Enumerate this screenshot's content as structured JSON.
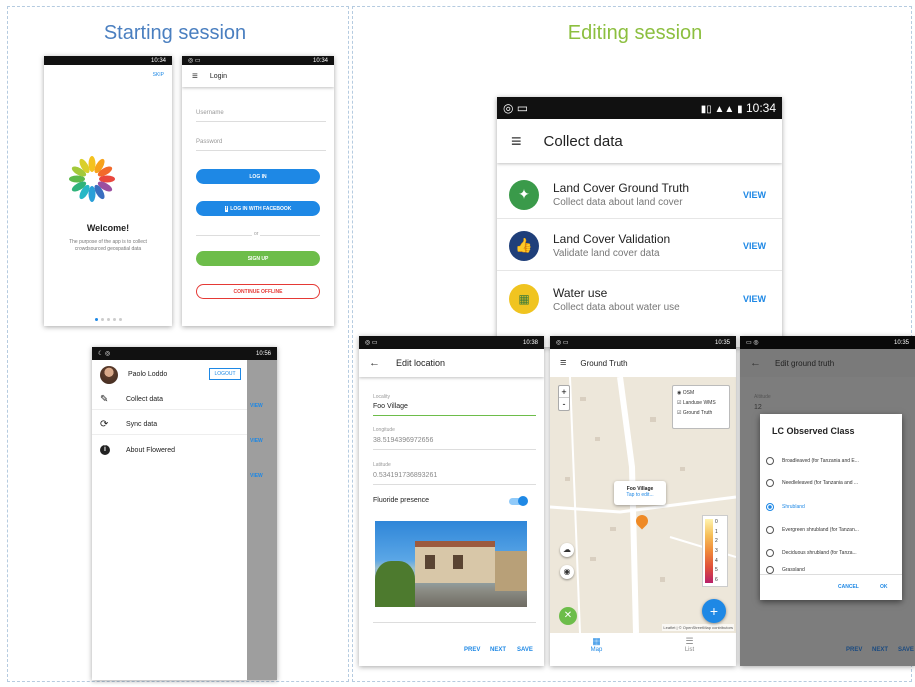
{
  "sections": {
    "starting": "Starting session",
    "editing": "Editing session"
  },
  "colors": {
    "blue": "#1e88e5",
    "green": "#6dbd4a",
    "red": "#e53935",
    "title_blue": "#4a7fc0",
    "title_green": "#8cbf3f"
  },
  "status": {
    "t1034": "10:34",
    "t1056": "10:56",
    "t1038": "10:38",
    "t1035": "10:35"
  },
  "welcome": {
    "skip": "SKIP",
    "title": "Welcome!",
    "desc": "The purpose of the app is to collect crowdsourced geospatial data",
    "logo_icon": "flower-logo-icon"
  },
  "login": {
    "title": "Login",
    "username": "Username",
    "password": "Password",
    "login_btn": "LOG IN",
    "facebook_btn": "LOG IN WITH FACEBOOK",
    "or": "or",
    "signup_btn": "SIGN UP",
    "offline_btn": "CONTINUE OFFLINE"
  },
  "drawer": {
    "user": "Paolo Loddo",
    "logout": "LOGOUT",
    "items": [
      {
        "label": "Collect data",
        "icon": "pencil-icon"
      },
      {
        "label": "Sync data",
        "icon": "sync-icon"
      },
      {
        "label": "About Flowered",
        "icon": "info-icon"
      }
    ],
    "bg_views": [
      "VIEW",
      "VIEW",
      "VIEW"
    ]
  },
  "collect": {
    "title": "Collect data",
    "items": [
      {
        "title": "Land Cover Ground Truth",
        "desc": "Collect data about land cover",
        "action": "VIEW",
        "icon": "compass-icon"
      },
      {
        "title": "Land Cover Validation",
        "desc": "Validate land cover data",
        "action": "VIEW",
        "icon": "thumbs-up-icon"
      },
      {
        "title": "Water use",
        "desc": "Collect data about water use",
        "action": "VIEW",
        "icon": "map-icon"
      }
    ]
  },
  "edit_location": {
    "title": "Edit location",
    "locality_label": "Locality",
    "locality_value": "Foo Village",
    "longitude_label": "Longitude",
    "longitude_value": "38.5194396972656",
    "latitude_label": "Latitude",
    "latitude_value": "0.534191736893261",
    "fluoride_label": "Fluoride presence",
    "fluoride_on": true,
    "prev": "PREV",
    "next": "NEXT",
    "save": "SAVE"
  },
  "ground_truth": {
    "title": "Ground Truth",
    "layers": [
      "OSM",
      "Landuse WMS",
      "Ground Truth"
    ],
    "popup_title": "Foo Village",
    "popup_link": "Tap to edit...",
    "legend": [
      "0",
      "1",
      "2",
      "3",
      "4",
      "5",
      "6"
    ],
    "zoom_in": "+",
    "zoom_out": "-",
    "attribution": "Leaflet | © OpenStreetMap contributors",
    "fab": "+",
    "tab_map": "Map",
    "tab_list": "List"
  },
  "edit_gt": {
    "title": "Edit ground truth",
    "altitude_label": "Altitude",
    "altitude_value": "12",
    "dialog_title": "LC Observed Class",
    "options": [
      "Broadleaved (for Tanzania and E...",
      "Needleleaved (for Tanzania and ...",
      "Shrubland",
      "Evergreen shrubland (for Tanzan...",
      "Deciduous shrubland (for Tanza...",
      "Grassland"
    ],
    "selected": 2,
    "cancel": "CANCEL",
    "ok": "OK",
    "prev": "PREV",
    "next": "NEXT",
    "save": "SAVE"
  }
}
